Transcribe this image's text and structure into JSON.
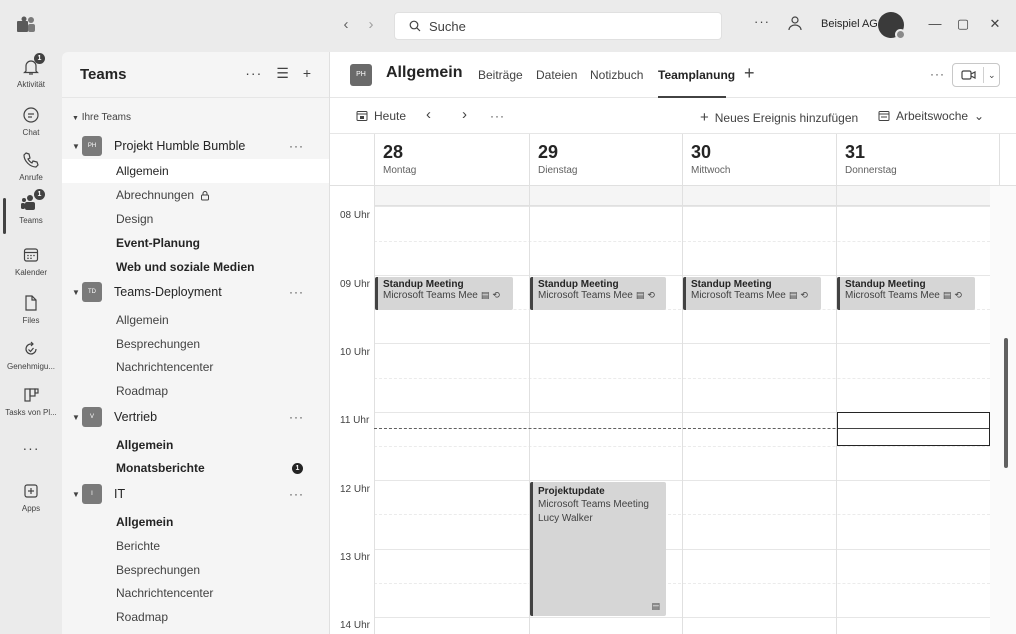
{
  "titlebar": {
    "search_placeholder": "Suche",
    "more": "···",
    "org_name": "Beispiel AG",
    "window_minimize": "—",
    "window_restore": "▢",
    "window_close": "✕"
  },
  "rail": {
    "items": [
      {
        "label": "Aktivität",
        "icon": "bell-icon",
        "badge": "1"
      },
      {
        "label": "Chat",
        "icon": "chat-icon"
      },
      {
        "label": "Anrufe",
        "icon": "phone-icon"
      },
      {
        "label": "Teams",
        "icon": "teams-icon",
        "badge": "1",
        "active": true
      },
      {
        "label": "Kalender",
        "icon": "calendar-icon"
      },
      {
        "label": "Files",
        "icon": "file-icon"
      },
      {
        "label": "Genehmigu...",
        "icon": "approvals-icon"
      },
      {
        "label": "Tasks von Pl...",
        "icon": "tasks-icon"
      },
      {
        "label": "···",
        "icon": "more-icon"
      },
      {
        "label": "Apps",
        "icon": "apps-icon"
      }
    ]
  },
  "teams_panel": {
    "title": "Teams",
    "section_label": "Ihre Teams",
    "teams": [
      {
        "initials": "PH",
        "name": "Projekt Humble Bumble",
        "more": "···",
        "channels": [
          {
            "name": "Allgemein",
            "selected": true
          },
          {
            "name": "Abrechnungen",
            "locked": true
          },
          {
            "name": "Design"
          },
          {
            "name": "Event-Planung",
            "bold": true
          },
          {
            "name": "Web und soziale Medien",
            "bold": true
          }
        ]
      },
      {
        "initials": "TD",
        "name": "Teams-Deployment",
        "more": "···",
        "channels": [
          {
            "name": "Allgemein"
          },
          {
            "name": "Besprechungen"
          },
          {
            "name": "Nachrichtencenter"
          },
          {
            "name": "Roadmap"
          }
        ]
      },
      {
        "initials": "V",
        "name": "Vertrieb",
        "more": "···",
        "channels": [
          {
            "name": "Allgemein",
            "bold": true
          },
          {
            "name": "Monatsberichte",
            "bold": true,
            "badge": "1"
          }
        ]
      },
      {
        "initials": "I",
        "name": "IT",
        "more": "···",
        "channels": [
          {
            "name": "Allgemein",
            "bold": true
          },
          {
            "name": "Berichte"
          },
          {
            "name": "Besprechungen"
          },
          {
            "name": "Nachrichtencenter"
          },
          {
            "name": "Roadmap"
          }
        ]
      }
    ]
  },
  "channel_header": {
    "initials": "PH",
    "title": "Allgemein",
    "tabs": [
      "Beiträge",
      "Dateien",
      "Notizbuch",
      "Teamplanung"
    ],
    "active_tab": "Teamplanung",
    "more": "···"
  },
  "toolbar": {
    "today": "Heute",
    "more": "···",
    "new_event": "Neues Ereignis hinzufügen",
    "view": "Arbeitswoche"
  },
  "calendar": {
    "days": [
      {
        "num": "28",
        "name": "Montag"
      },
      {
        "num": "29",
        "name": "Dienstag"
      },
      {
        "num": "30",
        "name": "Mittwoch"
      },
      {
        "num": "31",
        "name": "Donnerstag"
      }
    ],
    "hours": [
      "08 Uhr",
      "09 Uhr",
      "10 Uhr",
      "11 Uhr",
      "12 Uhr",
      "13 Uhr",
      "14 Uhr"
    ],
    "events": [
      {
        "day": 0,
        "title": "Standup Meeting",
        "sub": "Microsoft Teams Mee"
      },
      {
        "day": 1,
        "title": "Standup Meeting",
        "sub": "Microsoft Teams Mee"
      },
      {
        "day": 2,
        "title": "Standup Meeting",
        "sub": "Microsoft Teams Mee"
      },
      {
        "day": 3,
        "title": "Standup Meeting",
        "sub": "Microsoft Teams Mee"
      }
    ],
    "long_event": {
      "title": "Projektupdate",
      "location": "Microsoft Teams Meeting",
      "organizer": "Lucy Walker"
    }
  }
}
